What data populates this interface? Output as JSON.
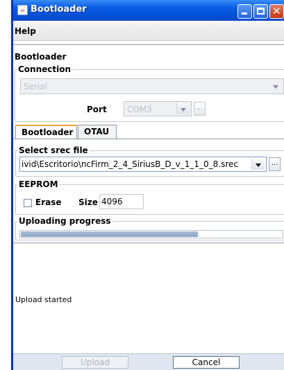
{
  "window": {
    "title": "Bootloader"
  },
  "menu": {
    "help": "Help"
  },
  "section": {
    "title": "Bootloader"
  },
  "connection": {
    "legend": "Connection",
    "type_value": "Serial",
    "port_label": "Port",
    "port_value": "COM3",
    "browse_label": "..."
  },
  "tabs": [
    {
      "label": "Bootloader",
      "active": true
    },
    {
      "label": "OTAU",
      "active": false
    }
  ],
  "srec": {
    "legend": "Select srec file",
    "file_value": "ivid\\Escritorio\\ncFirm_2_4_SiriusB_D_v_1_1_0_8.srec",
    "browse_label": "..."
  },
  "eeprom": {
    "legend": "EEPROM",
    "erase_label": "Erase",
    "erase_checked": false,
    "size_label": "Size",
    "size_value": "4096"
  },
  "progress": {
    "legend": "Uploading progress",
    "fraction": 0.68
  },
  "log": {
    "lines": [
      "Upload started"
    ]
  },
  "footer": {
    "upload_label": "Upload",
    "cancel_label": "Cancel"
  },
  "colors": {
    "title_bar": "#0552d9",
    "tab_accent": "#e9a33a",
    "progress_fill": "#8ca6c6"
  }
}
